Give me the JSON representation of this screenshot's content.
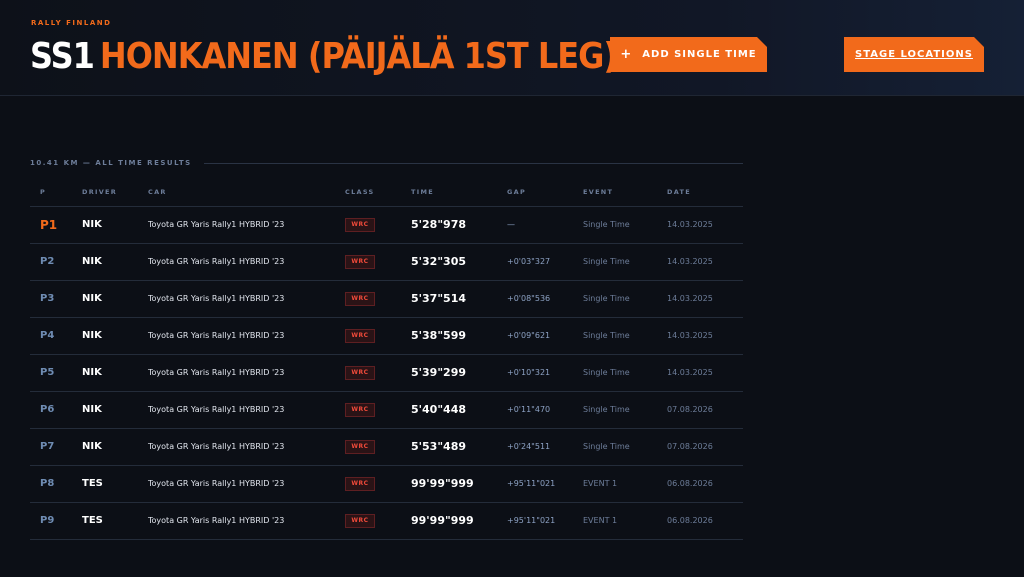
{
  "header": {
    "kicker": "RALLY FINLAND",
    "stage_code": "SS1",
    "stage_name": "HONKANEN (PÄIJÄLÄ 1ST LEG)",
    "add_button": {
      "icon": "plus-icon",
      "label": "ADD SINGLE TIME"
    },
    "stage_button": {
      "label": "STAGE LOCATIONS"
    }
  },
  "section": {
    "title": "10.41 KM — ALL TIME RESULTS"
  },
  "table": {
    "columns": {
      "pos": "P",
      "driver": "DRIVER",
      "car": "CAR",
      "class": "CLASS",
      "time": "TIME",
      "gap": "GAP",
      "event": "EVENT",
      "date": "DATE"
    },
    "rows": [
      {
        "pos": "P1",
        "driver": "NIK",
        "car": "Toyota GR Yaris Rally1 HYBRID '23",
        "class": "WRC",
        "time": "5'28\"978",
        "gap": "—",
        "event": "Single Time",
        "date": "14.03.2025"
      },
      {
        "pos": "P2",
        "driver": "NIK",
        "car": "Toyota GR Yaris Rally1 HYBRID '23",
        "class": "WRC",
        "time": "5'32\"305",
        "gap": "+0'03\"327",
        "event": "Single Time",
        "date": "14.03.2025"
      },
      {
        "pos": "P3",
        "driver": "NIK",
        "car": "Toyota GR Yaris Rally1 HYBRID '23",
        "class": "WRC",
        "time": "5'37\"514",
        "gap": "+0'08\"536",
        "event": "Single Time",
        "date": "14.03.2025"
      },
      {
        "pos": "P4",
        "driver": "NIK",
        "car": "Toyota GR Yaris Rally1 HYBRID '23",
        "class": "WRC",
        "time": "5'38\"599",
        "gap": "+0'09\"621",
        "event": "Single Time",
        "date": "14.03.2025"
      },
      {
        "pos": "P5",
        "driver": "NIK",
        "car": "Toyota GR Yaris Rally1 HYBRID '23",
        "class": "WRC",
        "time": "5'39\"299",
        "gap": "+0'10\"321",
        "event": "Single Time",
        "date": "14.03.2025"
      },
      {
        "pos": "P6",
        "driver": "NIK",
        "car": "Toyota GR Yaris Rally1 HYBRID '23",
        "class": "WRC",
        "time": "5'40\"448",
        "gap": "+0'11\"470",
        "event": "Single Time",
        "date": "07.08.2026"
      },
      {
        "pos": "P7",
        "driver": "NIK",
        "car": "Toyota GR Yaris Rally1 HYBRID '23",
        "class": "WRC",
        "time": "5'53\"489",
        "gap": "+0'24\"511",
        "event": "Single Time",
        "date": "07.08.2026"
      },
      {
        "pos": "P8",
        "driver": "TES",
        "car": "Toyota GR Yaris Rally1 HYBRID '23",
        "class": "WRC",
        "time": "99'99\"999",
        "gap": "+95'11\"021",
        "event": "EVENT 1",
        "date": "06.08.2026"
      },
      {
        "pos": "P9",
        "driver": "TES",
        "car": "Toyota GR Yaris Rally1 HYBRID '23",
        "class": "WRC",
        "time": "99'99\"999",
        "gap": "+95'11\"021",
        "event": "EVENT 1",
        "date": "06.08.2026"
      }
    ]
  },
  "colors": {
    "accent": "#f26a1b",
    "background": "#0c0f16",
    "class_badge": "#f04a3a"
  }
}
